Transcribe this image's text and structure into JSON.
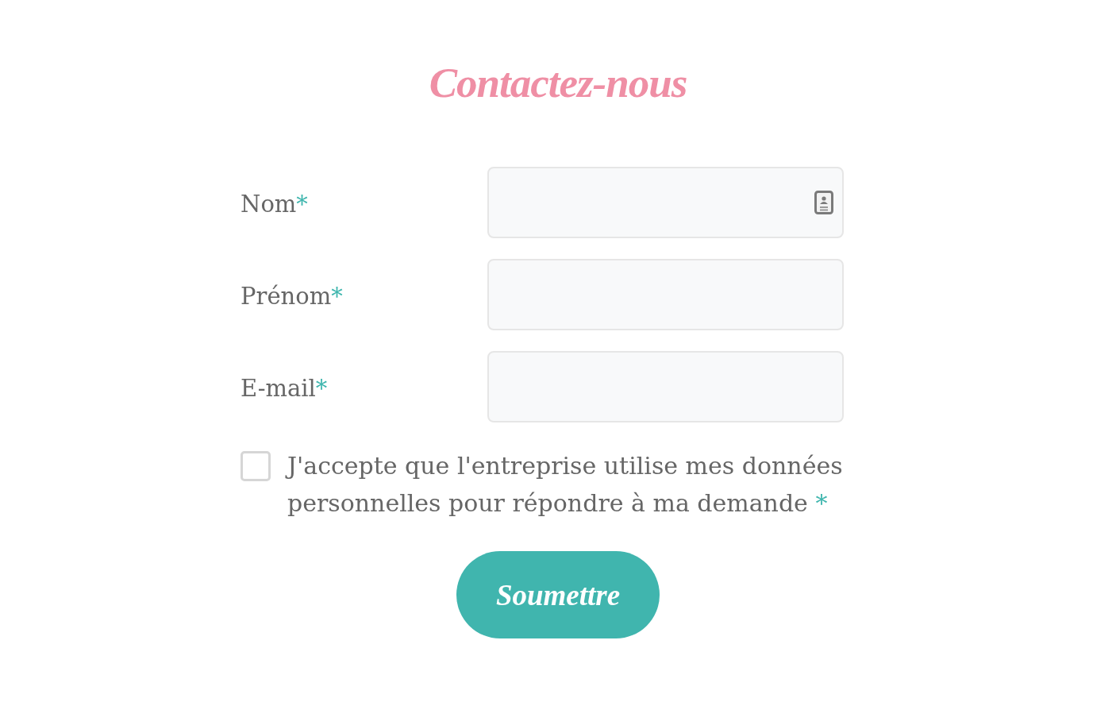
{
  "title": "Contactez-nous",
  "fields": [
    {
      "label": "Nom",
      "required_mark": "*",
      "contact_card_icon": true
    },
    {
      "label": "Prénom",
      "required_mark": "*",
      "contact_card_icon": false
    },
    {
      "label": "E-mail",
      "required_mark": "*",
      "contact_card_icon": false
    }
  ],
  "consent": {
    "text": "J'accepte que l'entreprise utilise mes données personnelles pour répondre à ma demande",
    "required_mark": "*",
    "checked": false
  },
  "submit": {
    "label": "Soumettre"
  }
}
